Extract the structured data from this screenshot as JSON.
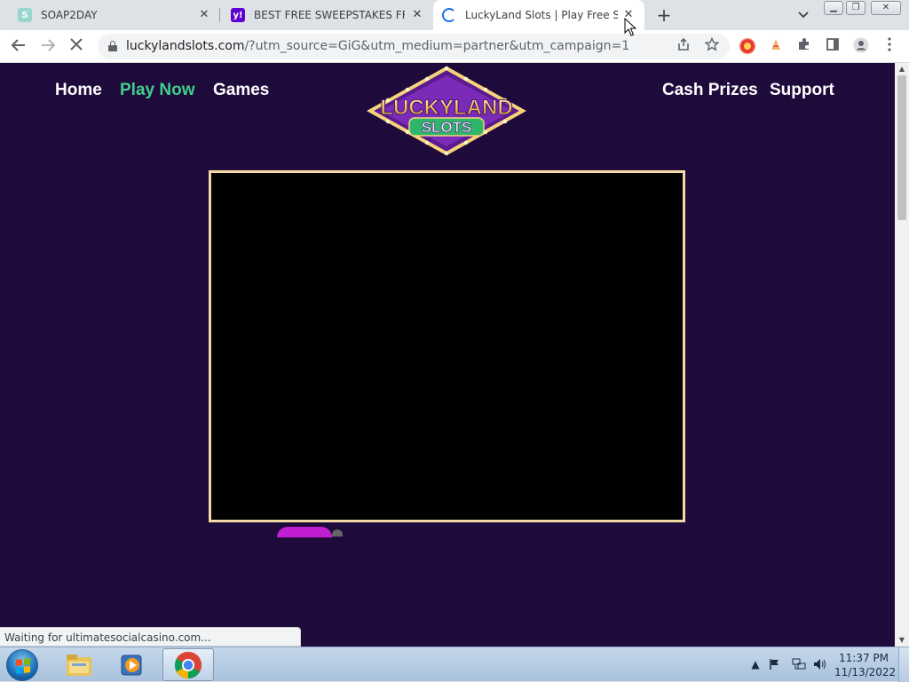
{
  "browser": {
    "tabs": [
      {
        "title": "SOAP2DAY",
        "favicon_letter": "S",
        "favicon_color": "#9ad6d0",
        "active": false
      },
      {
        "title": "BEST FREE SWEEPSTAKES FREE N",
        "favicon_letter": "y!",
        "favicon_color": "#5f01d1",
        "active": false
      },
      {
        "title": "LuckyLand Slots | Play Free Slot C",
        "loading": true,
        "active": true
      }
    ],
    "new_tab_icon": "+",
    "tab_search_icon": "chevron-down",
    "window_controls": [
      "minimize",
      "restore",
      "close"
    ],
    "address": {
      "host": "luckylandslots.com",
      "path": "/?utm_source=GiG&utm_medium=partner&utm_campaign=1"
    },
    "status_text": "Waiting for ultimatesocialcasino.com..."
  },
  "site": {
    "nav_left": [
      "Home",
      "Play Now",
      "Games"
    ],
    "nav_right": [
      "Cash Prizes",
      "Support"
    ],
    "active_nav": "Play Now",
    "logo": {
      "line1": "LUCKYLAND",
      "line2": "SLOTS"
    },
    "colors": {
      "background": "#1f0a3c",
      "active_nav": "#3fd08a",
      "frame_border": "#f3d9a4"
    }
  },
  "taskbar": {
    "clock_time": "11:37 PM",
    "clock_date": "11/13/2022",
    "pinned": [
      "windows-explorer",
      "media-player",
      "chrome"
    ]
  }
}
